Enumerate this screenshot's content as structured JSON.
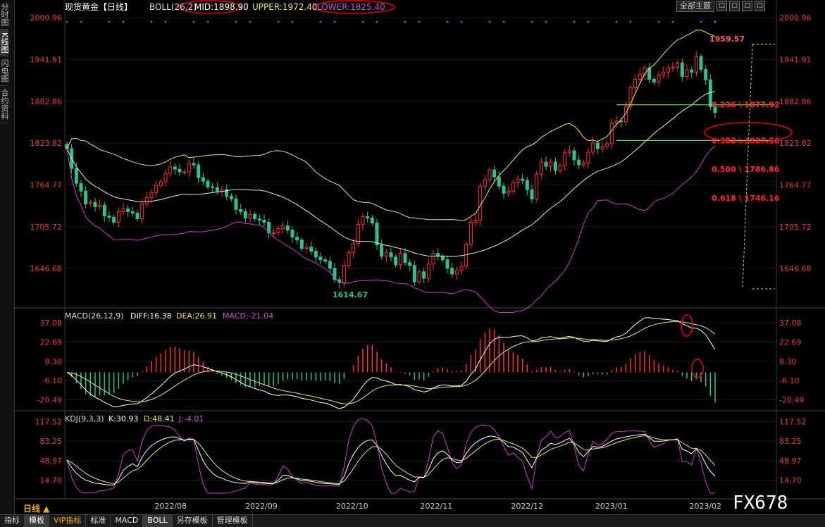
{
  "left_tabs": [
    "分时图",
    "K线图",
    "闪电图",
    "合约资料"
  ],
  "header": {
    "title": "现货黄金【日线】",
    "boll_label": "BOLL(26,2)",
    "mid_label": "MID:1898.90",
    "upper_label": "UPPER:1972.40",
    "lower_label": "LOWER:1825.40",
    "theme_button": "全部主题",
    "controls": [
      "□",
      "□",
      "□",
      "□"
    ]
  },
  "macd_header": {
    "name": "MACD(26,12,9)",
    "diff": "DIFF:16.38",
    "dea": "DEA:26.91",
    "macd": "MACD:-21.04"
  },
  "kdj_header": {
    "name": "KDJ(9,3,3)",
    "k": "K:30.93",
    "d": "D:48.41",
    "j": "J:-4.01"
  },
  "bottom_tabs": [
    "指标",
    "模板",
    "VIP指标",
    "标准",
    "MACD",
    "BOLL",
    "另存模板",
    "管理模板"
  ],
  "period_label": "日线 ▲",
  "watermark": "FX678",
  "colors": {
    "up": "#ff3333",
    "down": "#2ec28e",
    "mid": "#e8e8c8",
    "upper": "#e6e65a",
    "lower": "#c83cc8",
    "fib": "#ff2a2a",
    "fibline": "#9aff3a"
  },
  "chart_data": [
    {
      "type": "candlestick",
      "title": "现货黄金【日线】",
      "y_ticks": [
        2000.96,
        1941.91,
        1882.86,
        1823.82,
        1764.77,
        1705.72,
        1646.68
      ],
      "ylim": [
        1608,
        2008
      ],
      "x_labels": [
        "2022/08",
        "2022/09",
        "2022/10",
        "2022/11",
        "2022/12",
        "2023/01",
        "2023/02"
      ],
      "close": [
        1816,
        1788,
        1767,
        1756,
        1738,
        1740,
        1734,
        1736,
        1721,
        1719,
        1712,
        1727,
        1731,
        1727,
        1725,
        1717,
        1738,
        1747,
        1754,
        1764,
        1769,
        1781,
        1790,
        1787,
        1783,
        1783,
        1795,
        1793,
        1775,
        1770,
        1762,
        1761,
        1756,
        1758,
        1749,
        1745,
        1730,
        1727,
        1718,
        1723,
        1717,
        1715,
        1712,
        1697,
        1697,
        1703,
        1707,
        1701,
        1691,
        1687,
        1675,
        1677,
        1671,
        1663,
        1659,
        1657,
        1647,
        1631,
        1627,
        1651,
        1669,
        1682,
        1709,
        1720,
        1718,
        1711,
        1680,
        1664,
        1669,
        1663,
        1652,
        1668,
        1655,
        1651,
        1628,
        1642,
        1633,
        1653,
        1668,
        1664,
        1659,
        1647,
        1639,
        1644,
        1650,
        1681,
        1712,
        1715,
        1763,
        1772,
        1786,
        1776,
        1763,
        1753,
        1756,
        1768,
        1773,
        1771,
        1758,
        1745,
        1780,
        1797,
        1791,
        1797,
        1785,
        1792,
        1810,
        1813,
        1800,
        1793,
        1796,
        1811,
        1824,
        1816,
        1819,
        1823,
        1852,
        1855,
        1854,
        1875,
        1902,
        1914,
        1921,
        1930,
        1914,
        1910,
        1920,
        1924,
        1930,
        1931,
        1937,
        1918,
        1927,
        1924,
        1946,
        1928,
        1913,
        1875,
        1867
      ],
      "highlight_high": "1959.57",
      "highlight_low": "1614.67",
      "fibonacci": [
        {
          "label": "0.236 \\ 1877.92",
          "value": 1877.92
        },
        {
          "label": "0.382 \\ 1827.56",
          "value": 1827.56
        },
        {
          "label": "0.500 \\ 1786.86",
          "value": 1786.86
        },
        {
          "label": "0.618 \\ 1746.16",
          "value": 1746.16
        }
      ]
    },
    {
      "type": "macd",
      "title": "MACD(26,12,9)",
      "y_ticks": [
        37.08,
        22.69,
        8.3,
        -6.1,
        -20.49
      ],
      "ylim": [
        -26,
        44
      ]
    },
    {
      "type": "kdj",
      "title": "KDJ(9,3,3)",
      "y_ticks": [
        117.52,
        83.25,
        48.97,
        14.7
      ],
      "ylim": [
        -8,
        128
      ]
    }
  ]
}
